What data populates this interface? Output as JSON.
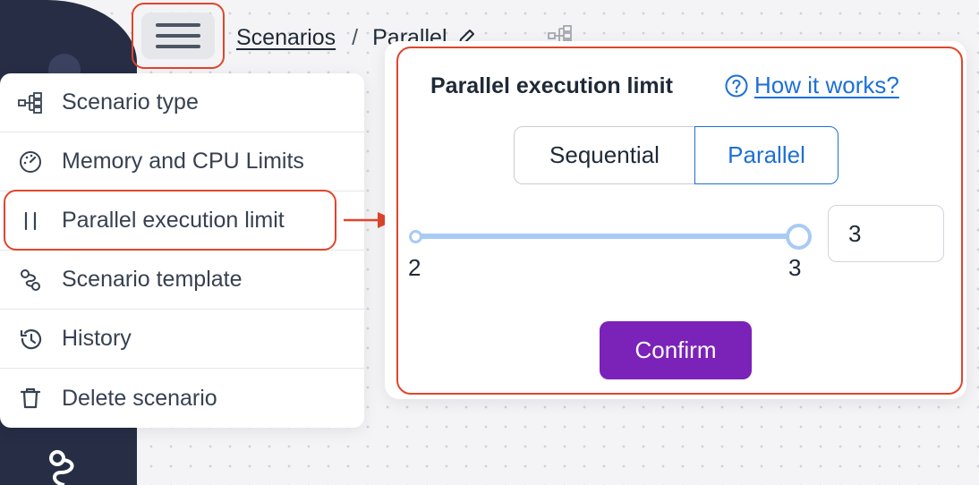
{
  "breadcrumb": {
    "link": "Scenarios",
    "separator": "/",
    "current": "Parallel"
  },
  "menu": {
    "items": [
      {
        "label": "Scenario type",
        "icon": "flow-type-icon"
      },
      {
        "label": "Memory and CPU Limits",
        "icon": "gauge-icon"
      },
      {
        "label": "Parallel execution limit",
        "icon": "pause-bars-icon"
      },
      {
        "label": "Scenario template",
        "icon": "route-icon"
      },
      {
        "label": "History",
        "icon": "history-icon"
      },
      {
        "label": "Delete scenario",
        "icon": "trash-icon"
      }
    ]
  },
  "popup": {
    "title": "Parallel execution limit",
    "help_link": "How it works?",
    "modes": {
      "sequential": "Sequential",
      "parallel": "Parallel",
      "selected": "Parallel"
    },
    "slider": {
      "min_label": "2",
      "max_label": "3",
      "value": 3
    },
    "limit_value": "3",
    "confirm_label": "Confirm"
  },
  "colors": {
    "accent": "#1d6fd8",
    "confirm": "#7b22b8",
    "highlight": "#e0452c",
    "rail": "#262d44"
  }
}
